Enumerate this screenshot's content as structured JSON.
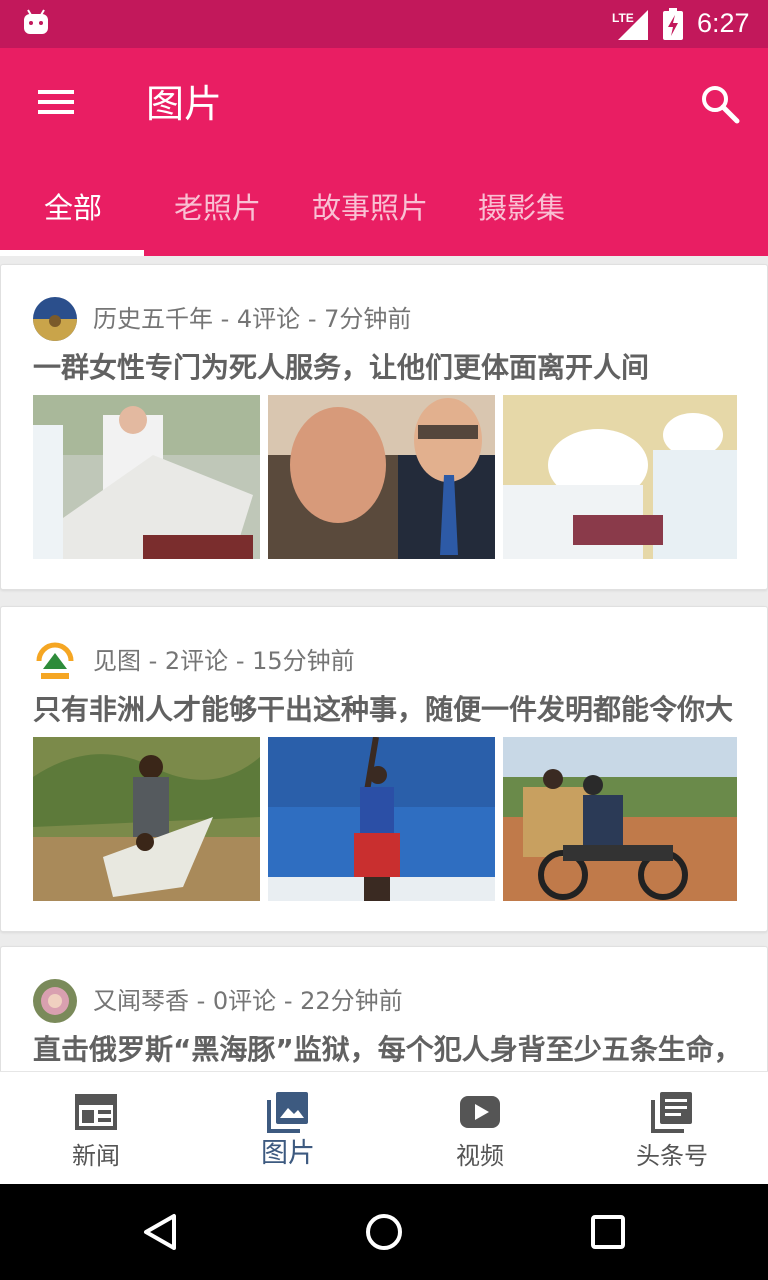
{
  "status_bar": {
    "time": "6:27",
    "network": "LTE"
  },
  "app_bar": {
    "title": "图片"
  },
  "tabs": [
    {
      "label": "全部",
      "active": true
    },
    {
      "label": "老照片",
      "active": false
    },
    {
      "label": "故事照片",
      "active": false
    },
    {
      "label": "摄影集",
      "active": false
    }
  ],
  "feed": [
    {
      "source": "历史五千年",
      "comments": "4评论",
      "time": "7分钟前",
      "meta": "历史五千年 - 4评论 - 7分钟前",
      "title": "一群女性专门为死人服务，让他们更体面离开人间"
    },
    {
      "source": "见图",
      "comments": "2评论",
      "time": "15分钟前",
      "meta": "见图 - 2评论 - 15分钟前",
      "title": "只有非洲人才能够干出这种事，随便一件发明都能令你大"
    },
    {
      "source": "又闻琴香",
      "comments": "0评论",
      "time": "22分钟前",
      "meta": "又闻琴香 - 0评论 - 22分钟前",
      "title": "直击俄罗斯“黑海豚”监狱，每个犯人身背至少五条生命，"
    }
  ],
  "bottom_nav": [
    {
      "label": "新闻",
      "icon": "newspaper-icon",
      "active": false
    },
    {
      "label": "图片",
      "icon": "photo-library-icon",
      "active": true
    },
    {
      "label": "视频",
      "icon": "video-play-icon",
      "active": false
    },
    {
      "label": "头条号",
      "icon": "article-list-icon",
      "active": false
    }
  ],
  "colors": {
    "primary": "#e91e63",
    "primary_dark": "#c2185b",
    "nav_active": "#3d5a80"
  }
}
